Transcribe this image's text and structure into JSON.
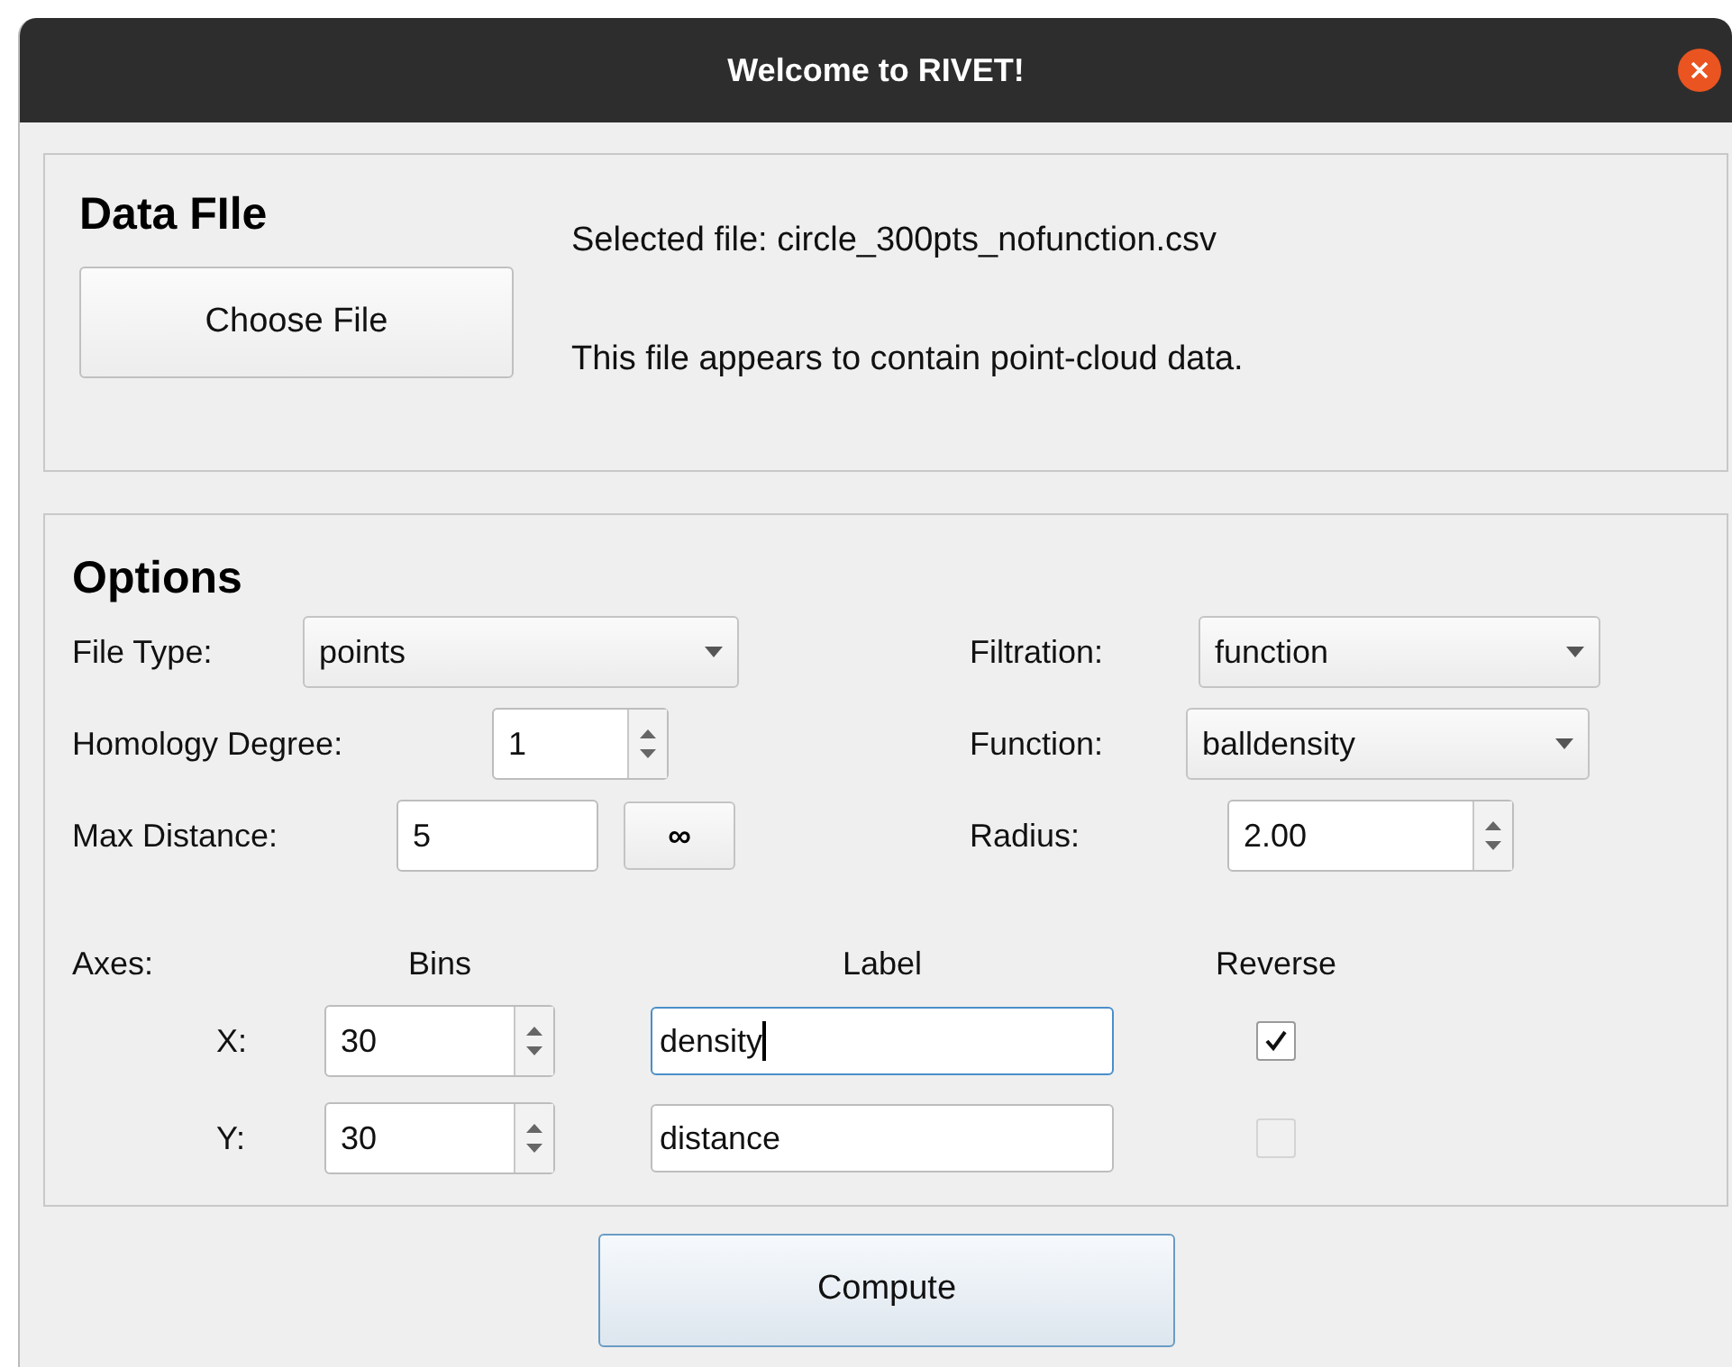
{
  "window": {
    "title": "Welcome to RIVET!"
  },
  "data_file": {
    "heading": "Data FIle",
    "choose_button": "Choose File",
    "selected_text": "Selected file: circle_300pts_nofunction.csv",
    "info_text": "This file appears to contain point-cloud data."
  },
  "options": {
    "heading": "Options",
    "left_fields": [
      {
        "kind": "combo",
        "label": "File Type:",
        "value": "points"
      },
      {
        "kind": "spin",
        "label": "Homology Degree:",
        "value": "1"
      },
      {
        "kind": "text_button",
        "label": "Max Distance:",
        "value": "5",
        "button": "∞"
      }
    ],
    "right_fields": [
      {
        "kind": "combo",
        "label": "Filtration:",
        "value": "function"
      },
      {
        "kind": "combo",
        "label": "Function:",
        "value": "balldensity"
      },
      {
        "kind": "spin",
        "label": "Radius:",
        "value": "2.00"
      }
    ],
    "axes_headers": [
      "Axes:",
      "Bins",
      "Label",
      "Reverse"
    ],
    "axes": [
      {
        "axis": "X:",
        "bins": "30",
        "label": "density",
        "focused": true,
        "reverse": true,
        "disabled": false
      },
      {
        "axis": "Y:",
        "bins": "30",
        "label": "distance",
        "focused": false,
        "reverse": false,
        "disabled": true
      }
    ]
  },
  "compute_button": "Compute"
}
